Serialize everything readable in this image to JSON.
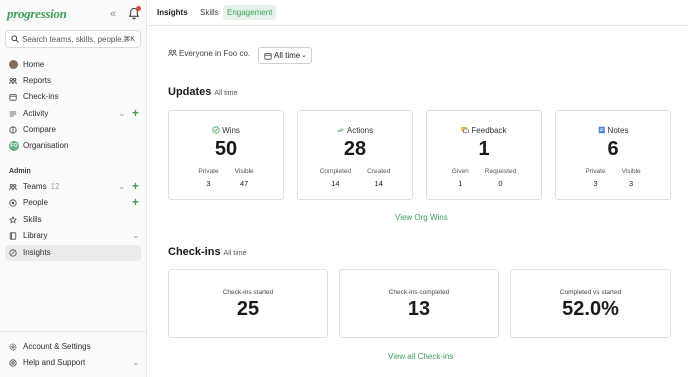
{
  "app": {
    "logo_text": "progression"
  },
  "search": {
    "placeholder": "Search teams, skills, people...",
    "shortcut": "⌘K"
  },
  "sidebar": {
    "items": [
      {
        "label": "Home"
      },
      {
        "label": "Reports"
      },
      {
        "label": "Check-ins"
      },
      {
        "label": "Activity"
      },
      {
        "label": "Compare"
      },
      {
        "label": "Organisation"
      }
    ],
    "admin_label": "Admin",
    "admin_items": [
      {
        "label": "Teams",
        "count": "12"
      },
      {
        "label": "People"
      },
      {
        "label": "Skills"
      },
      {
        "label": "Library"
      },
      {
        "label": "Insights"
      }
    ],
    "footer_items": [
      {
        "label": "Account & Settings"
      },
      {
        "label": "Help and Support"
      }
    ]
  },
  "tabs": [
    {
      "label": "Insights"
    },
    {
      "label": "Skills"
    },
    {
      "label": "Engagement"
    }
  ],
  "filters": {
    "scope": "Everyone in Foo co.",
    "time": "All time"
  },
  "updates": {
    "title": "Updates",
    "subtitle": "All time",
    "cards": [
      {
        "label": "Wins",
        "value": "50",
        "subs": [
          {
            "label": "Private",
            "value": "3"
          },
          {
            "label": "Visible",
            "value": "47"
          }
        ]
      },
      {
        "label": "Actions",
        "value": "28",
        "subs": [
          {
            "label": "Completed",
            "value": "14"
          },
          {
            "label": "Created",
            "value": "14"
          }
        ]
      },
      {
        "label": "Feedback",
        "value": "1",
        "subs": [
          {
            "label": "Given",
            "value": "1"
          },
          {
            "label": "Requested",
            "value": "0"
          }
        ]
      },
      {
        "label": "Notes",
        "value": "6",
        "subs": [
          {
            "label": "Private",
            "value": "3"
          },
          {
            "label": "Visible",
            "value": "3"
          }
        ]
      }
    ],
    "link": "View Org Wins"
  },
  "checkins": {
    "title": "Check-ins",
    "subtitle": "All time",
    "cards": [
      {
        "label": "Check-ins started",
        "value": "25"
      },
      {
        "label": "Check-ins completed",
        "value": "13"
      },
      {
        "label": "Completed vs started",
        "value": "52.0%"
      }
    ],
    "link": "View all Check-ins"
  },
  "colors": {
    "brand": "#3f9e5a",
    "notification": "#e0453a",
    "tab_active_bg": "#e6f2e9"
  }
}
